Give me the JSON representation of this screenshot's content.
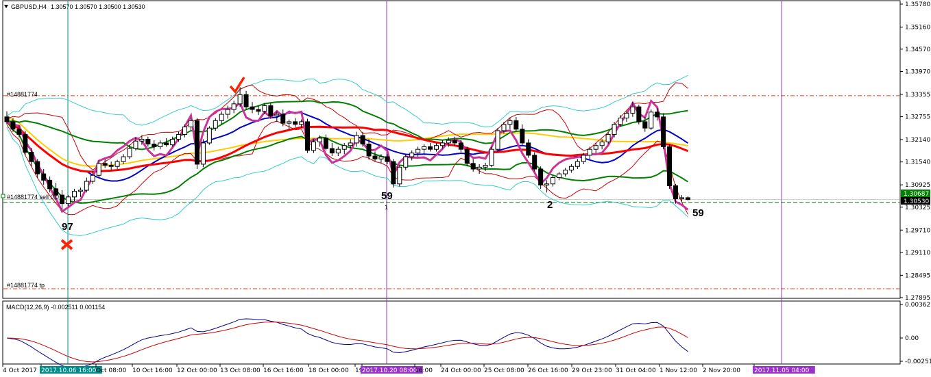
{
  "header": {
    "symbol": "GBPUSD,H4",
    "ohlc": "1.30570 1.30570 1.30500 1.30530"
  },
  "order_labels": {
    "order": "#14881774",
    "order_sell": "#14881774 sell 0.0",
    "order_tp": "#14881774 tp"
  },
  "markers": {
    "count_left": "97",
    "count_mid": "59",
    "count_mid_sub": "1",
    "count_right_mid": "2",
    "count_right": "59"
  },
  "price_badges": {
    "ask": "1.30687",
    "bid": "1.30530"
  },
  "macd": {
    "label": "MACD(12,26,9) -0.002511 0.001154"
  },
  "colors": {
    "bullish": "#ffffff",
    "bearish": "#000000",
    "ma_red": "#ff0000",
    "ma_blue": "#0000cc",
    "ma_green": "#008000",
    "ma_gold": "#ffcc00",
    "magenta": "#cc3399",
    "cyan": "#33cccc",
    "separator": "#9933cc",
    "macd_main": "#00008b",
    "macd_signal": "#cc0000"
  },
  "chart_data": [
    {
      "type": "candlestick",
      "symbol": "GBPUSD",
      "timeframe": "H4",
      "y_ticks": [
        "1.35780",
        "1.35160",
        "1.34570",
        "1.33970",
        "1.33355",
        "1.32755",
        "1.32140",
        "1.31540",
        "1.30925",
        "1.30325",
        "1.29710",
        "1.29110",
        "1.28495",
        "1.27895"
      ],
      "ylim": [
        1.27895,
        1.3578
      ],
      "x_labels": [
        "4 Oct 2017",
        "2017.10.06 16:00",
        "Oct 08:00",
        "10 Oct 16:00",
        "12 Oct 00:00",
        "13 Oct 08:00",
        "16 Oct 16:00",
        "18 Oct 00:00",
        "19",
        "2017.10.20 08:00",
        "16:00",
        "24 Oct 00:00",
        "25 Oct 08:00",
        "26 Oct 16:00",
        "29 Oct 23:00",
        "31 Oct 04:00",
        "1 Nov 12:00",
        "2 Nov 20:00",
        "2017.11.05 04:00"
      ],
      "highlighted_x_labels": [
        "2017.10.06 16:00",
        "2017.10.20 08:00",
        "2017.11.05 04:00"
      ],
      "levels": {
        "order_open": 1.3332,
        "order_sl_line": 1.30455,
        "order_tp": 1.28135,
        "current": 1.3053,
        "ask": 1.30687
      },
      "candles": [
        [
          1.3275,
          1.329,
          1.3255,
          1.3262
        ],
        [
          1.3262,
          1.3272,
          1.3235,
          1.3242
        ],
        [
          1.3242,
          1.3252,
          1.322,
          1.3228
        ],
        [
          1.3228,
          1.3238,
          1.3172,
          1.318
        ],
        [
          1.318,
          1.3192,
          1.3142,
          1.3155
        ],
        [
          1.3155,
          1.3162,
          1.3112,
          1.3122
        ],
        [
          1.3122,
          1.3135,
          1.3092,
          1.3105
        ],
        [
          1.3105,
          1.3115,
          1.3072,
          1.3082
        ],
        [
          1.3082,
          1.3098,
          1.3052,
          1.3065
        ],
        [
          1.3065,
          1.3078,
          1.3025,
          1.3042
        ],
        [
          1.3042,
          1.3065,
          1.3035,
          1.306
        ],
        [
          1.306,
          1.3082,
          1.3048,
          1.3075
        ],
        [
          1.3075,
          1.3085,
          1.306,
          1.3078
        ],
        [
          1.3078,
          1.3112,
          1.3072,
          1.3102
        ],
        [
          1.3102,
          1.3128,
          1.3095,
          1.3118
        ],
        [
          1.3118,
          1.3158,
          1.3112,
          1.315
        ],
        [
          1.315,
          1.3162,
          1.3138,
          1.3145
        ],
        [
          1.3145,
          1.3155,
          1.3132,
          1.3142
        ],
        [
          1.3142,
          1.316,
          1.3135,
          1.3155
        ],
        [
          1.3155,
          1.3175,
          1.3148,
          1.3168
        ],
        [
          1.3168,
          1.32,
          1.3162,
          1.319
        ],
        [
          1.319,
          1.322,
          1.3185,
          1.321
        ],
        [
          1.321,
          1.3225,
          1.32,
          1.3215
        ],
        [
          1.3215,
          1.3222,
          1.3195,
          1.3202
        ],
        [
          1.3202,
          1.3212,
          1.3185,
          1.3195
        ],
        [
          1.3195,
          1.3212,
          1.3188,
          1.3205
        ],
        [
          1.3205,
          1.3218,
          1.3195,
          1.32
        ],
        [
          1.32,
          1.3222,
          1.3195,
          1.3215
        ],
        [
          1.3215,
          1.3235,
          1.3208,
          1.3228
        ],
        [
          1.3228,
          1.3255,
          1.322,
          1.3248
        ],
        [
          1.3248,
          1.3272,
          1.324,
          1.3265
        ],
        [
          1.3265,
          1.3272,
          1.3135,
          1.3148
        ],
        [
          1.3148,
          1.3215,
          1.314,
          1.3205
        ],
        [
          1.3205,
          1.325,
          1.32,
          1.3245
        ],
        [
          1.3245,
          1.3272,
          1.3238,
          1.3265
        ],
        [
          1.3265,
          1.329,
          1.3255,
          1.3282
        ],
        [
          1.3282,
          1.3305,
          1.327,
          1.3295
        ],
        [
          1.3295,
          1.3318,
          1.3285,
          1.331
        ],
        [
          1.331,
          1.3355,
          1.3302,
          1.3335
        ],
        [
          1.3335,
          1.3345,
          1.3295,
          1.3302
        ],
        [
          1.3302,
          1.3315,
          1.3285,
          1.3295
        ],
        [
          1.3295,
          1.3305,
          1.328,
          1.329
        ],
        [
          1.329,
          1.3312,
          1.3282,
          1.3305
        ],
        [
          1.3305,
          1.3312,
          1.327,
          1.3278
        ],
        [
          1.3278,
          1.329,
          1.3262,
          1.3282
        ],
        [
          1.3282,
          1.3295,
          1.325,
          1.3258
        ],
        [
          1.3258,
          1.3268,
          1.324,
          1.3262
        ],
        [
          1.3262,
          1.3272,
          1.3248,
          1.3255
        ],
        [
          1.3255,
          1.3268,
          1.3245,
          1.3262
        ],
        [
          1.3262,
          1.327,
          1.3178,
          1.3185
        ],
        [
          1.3185,
          1.3215,
          1.3178,
          1.3208
        ],
        [
          1.3208,
          1.3225,
          1.3195,
          1.3218
        ],
        [
          1.3218,
          1.3228,
          1.3185,
          1.319
        ],
        [
          1.319,
          1.3205,
          1.317,
          1.3178
        ],
        [
          1.3178,
          1.3195,
          1.317,
          1.3188
        ],
        [
          1.3188,
          1.3205,
          1.3175,
          1.3198
        ],
        [
          1.3198,
          1.3215,
          1.319,
          1.3205
        ],
        [
          1.3205,
          1.3235,
          1.3195,
          1.3225
        ],
        [
          1.3225,
          1.3235,
          1.3195,
          1.3202
        ],
        [
          1.3202,
          1.3215,
          1.316,
          1.317
        ],
        [
          1.317,
          1.3182,
          1.3155,
          1.3162
        ],
        [
          1.3162,
          1.3175,
          1.315,
          1.3168
        ],
        [
          1.3168,
          1.3175,
          1.3148,
          1.3155
        ],
        [
          1.3155,
          1.3162,
          1.3085,
          1.3095
        ],
        [
          1.3095,
          1.3145,
          1.3088,
          1.314
        ],
        [
          1.314,
          1.3175,
          1.3132,
          1.3168
        ],
        [
          1.3168,
          1.3185,
          1.3158,
          1.3178
        ],
        [
          1.3178,
          1.3195,
          1.3168,
          1.3188
        ],
        [
          1.3188,
          1.3202,
          1.3175,
          1.3195
        ],
        [
          1.3195,
          1.3205,
          1.3182,
          1.3188
        ],
        [
          1.3188,
          1.3205,
          1.3182,
          1.3198
        ],
        [
          1.3198,
          1.3212,
          1.319,
          1.3205
        ],
        [
          1.3205,
          1.322,
          1.3195,
          1.3212
        ],
        [
          1.3212,
          1.3222,
          1.3198,
          1.3205
        ],
        [
          1.3205,
          1.3212,
          1.318,
          1.3188
        ],
        [
          1.3188,
          1.3195,
          1.3142,
          1.315
        ],
        [
          1.315,
          1.3162,
          1.3128,
          1.3135
        ],
        [
          1.3135,
          1.3148,
          1.3122,
          1.314
        ],
        [
          1.314,
          1.3152,
          1.313,
          1.3145
        ],
        [
          1.3145,
          1.3195,
          1.314,
          1.3188
        ],
        [
          1.3188,
          1.3245,
          1.318,
          1.3238
        ],
        [
          1.3238,
          1.3262,
          1.323,
          1.3255
        ],
        [
          1.3255,
          1.3272,
          1.3242,
          1.3265
        ],
        [
          1.3265,
          1.3275,
          1.3235,
          1.3242
        ],
        [
          1.3242,
          1.3255,
          1.3198,
          1.3205
        ],
        [
          1.3205,
          1.3215,
          1.3165,
          1.3172
        ],
        [
          1.3172,
          1.318,
          1.3128,
          1.3135
        ],
        [
          1.3135,
          1.3142,
          1.3082,
          1.3092
        ],
        [
          1.3092,
          1.3105,
          1.3072,
          1.3095
        ],
        [
          1.3095,
          1.3118,
          1.3088,
          1.3112
        ],
        [
          1.3112,
          1.3128,
          1.3105,
          1.3122
        ],
        [
          1.3122,
          1.3138,
          1.3115,
          1.3132
        ],
        [
          1.3132,
          1.3148,
          1.3125,
          1.3142
        ],
        [
          1.3142,
          1.3162,
          1.3135,
          1.3155
        ],
        [
          1.3155,
          1.3178,
          1.3148,
          1.3172
        ],
        [
          1.3172,
          1.3195,
          1.3162,
          1.3188
        ],
        [
          1.3188,
          1.3205,
          1.3178,
          1.3198
        ],
        [
          1.3198,
          1.3215,
          1.3188,
          1.3208
        ],
        [
          1.3208,
          1.3235,
          1.3202,
          1.3228
        ],
        [
          1.3228,
          1.3262,
          1.322,
          1.3255
        ],
        [
          1.3255,
          1.328,
          1.3248,
          1.3272
        ],
        [
          1.3272,
          1.329,
          1.3262,
          1.3285
        ],
        [
          1.3285,
          1.3315,
          1.3275,
          1.3302
        ],
        [
          1.3302,
          1.3308,
          1.3255,
          1.3262
        ],
        [
          1.3262,
          1.3275,
          1.3235,
          1.3245
        ],
        [
          1.3245,
          1.3295,
          1.324,
          1.3288
        ],
        [
          1.3288,
          1.3298,
          1.3265,
          1.3275
        ],
        [
          1.3275,
          1.3285,
          1.3188,
          1.3195
        ],
        [
          1.3195,
          1.3202,
          1.3082,
          1.309
        ],
        [
          1.309,
          1.3095,
          1.3042,
          1.3055
        ],
        [
          1.3055,
          1.3065,
          1.3048,
          1.3058
        ],
        [
          1.3058,
          1.3062,
          1.305,
          1.3053
        ]
      ],
      "macd_ylim": [
        -0.002511,
        0.003622
      ],
      "macd_ticks": [
        "0.003622",
        "0.00",
        "-0.002511"
      ]
    }
  ]
}
